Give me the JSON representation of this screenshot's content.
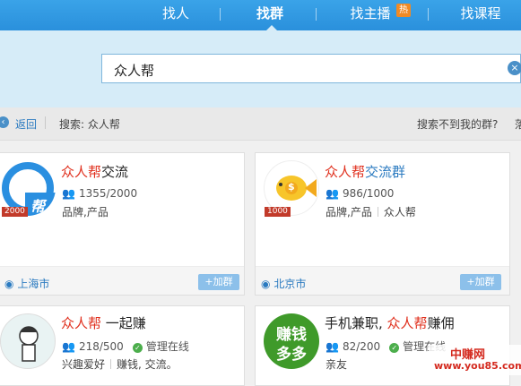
{
  "nav": {
    "tabs": [
      {
        "label": "找人"
      },
      {
        "label": "找群"
      },
      {
        "label": "找主播"
      },
      {
        "label": "找课程"
      }
    ],
    "hot_badge": "热",
    "active_tab": "找群"
  },
  "search": {
    "query": "众人帮",
    "clear_symbol": "×"
  },
  "subbar": {
    "back_label": "返回",
    "search_label": "搜索: 众人帮",
    "not_found_link": "搜索不到我的群?",
    "cut_link": "落"
  },
  "cards": [
    {
      "name_highlight": "众人帮",
      "name_rest": "交流",
      "members": "1355/2000",
      "tags": [
        "品牌,产品"
      ],
      "size_badge": "2000",
      "location": "上海市",
      "join_label": "+加群",
      "avatar_glyph": "帮"
    },
    {
      "name_highlight": "众人帮",
      "name_rest": "交流群",
      "members": "986/1000",
      "tags": [
        "品牌,产品",
        "众人帮"
      ],
      "size_badge": "1000",
      "location": "北京市",
      "join_label": "+加群",
      "avatar_glyph": "$"
    },
    {
      "name_highlight": "众人帮",
      "name_rest": " 一起赚",
      "members": "218/500",
      "managed": "管理在线",
      "tags": [
        "兴趣爱好",
        "赚钱, 交流。"
      ]
    },
    {
      "name_prefix": "手机兼职, ",
      "name_highlight": "众人帮",
      "name_rest": "赚佣",
      "members": "82/200",
      "managed": "管理在线",
      "tags": [
        "亲友"
      ],
      "avatar_line1": "赚钱",
      "avatar_line2": "多多"
    }
  ],
  "watermark": {
    "cn": "中赚网",
    "url": "www.you85.com"
  },
  "colors": {
    "accent": "#2a90dc",
    "highlight": "#e0301e",
    "link": "#2a7ac0",
    "join_button": "#8cc0ea"
  }
}
